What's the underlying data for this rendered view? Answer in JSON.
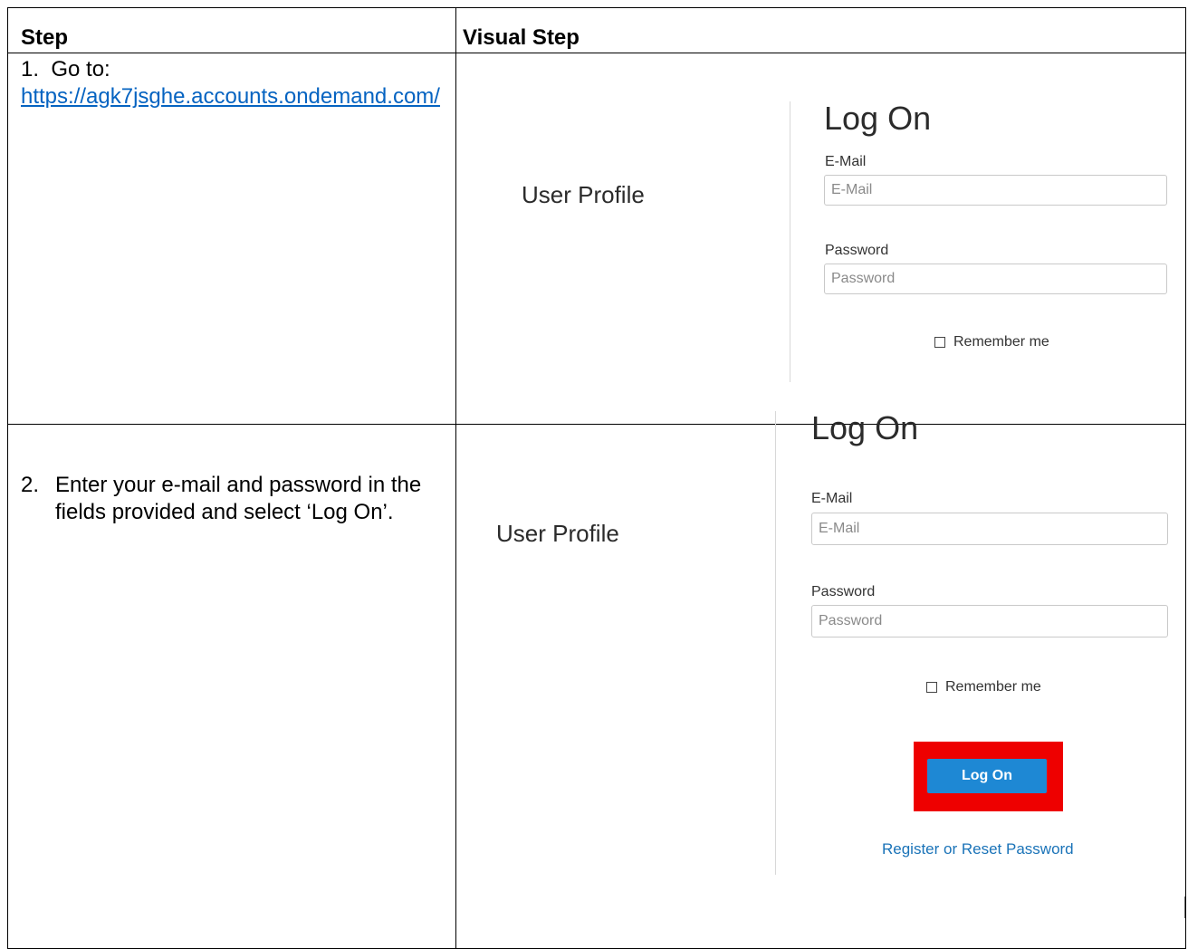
{
  "table": {
    "header_step": "Step",
    "header_visual": "Visual Step"
  },
  "step1": {
    "number": "1.",
    "text": "Go to:",
    "link": "https://agk7jsghe.accounts.ondemand.com/"
  },
  "step2": {
    "number": "2.",
    "text": "Enter your e-mail and password in the fields provided and select ‘Log On’."
  },
  "login1": {
    "side_label": "User Profile",
    "title": "Log On",
    "email_label": "E-Mail",
    "email_placeholder": "E-Mail",
    "password_label": "Password",
    "password_placeholder": "Password",
    "remember_label": "Remember me"
  },
  "login2": {
    "side_label": "User Profile",
    "title": "Log On",
    "email_label": "E-Mail",
    "email_placeholder": "E-Mail",
    "password_label": "Password",
    "password_placeholder": "Password",
    "remember_label": "Remember me",
    "logon_button": "Log On",
    "reset_link": "Register or Reset Password"
  },
  "colors": {
    "link": "#0563c1",
    "button": "#1e88d4",
    "highlight": "#ee0000"
  }
}
